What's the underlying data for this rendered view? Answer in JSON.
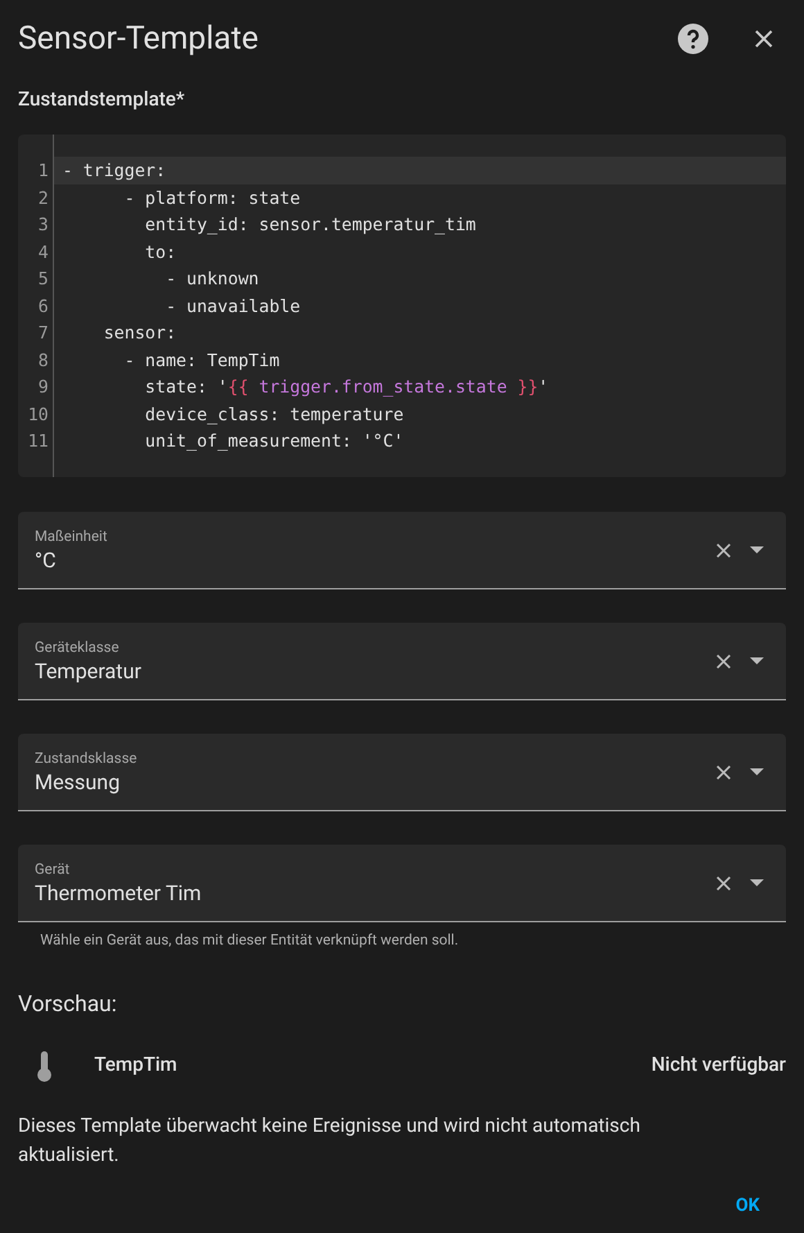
{
  "dialog": {
    "title": "Sensor-Template"
  },
  "template": {
    "label": "Zustandstemplate*",
    "lines": [
      {
        "number": "1",
        "active": true,
        "segments": [
          {
            "kind": "plain",
            "text": "- trigger:"
          }
        ]
      },
      {
        "number": "2",
        "active": false,
        "segments": [
          {
            "kind": "plain",
            "text": "      - platform: state"
          }
        ]
      },
      {
        "number": "3",
        "active": false,
        "segments": [
          {
            "kind": "plain",
            "text": "        entity_id: sensor.temperatur_tim"
          }
        ]
      },
      {
        "number": "4",
        "active": false,
        "segments": [
          {
            "kind": "plain",
            "text": "        to:"
          }
        ]
      },
      {
        "number": "5",
        "active": false,
        "segments": [
          {
            "kind": "plain",
            "text": "          - unknown"
          }
        ]
      },
      {
        "number": "6",
        "active": false,
        "segments": [
          {
            "kind": "plain",
            "text": "          - unavailable"
          }
        ]
      },
      {
        "number": "7",
        "active": false,
        "segments": [
          {
            "kind": "plain",
            "text": "    sensor:"
          }
        ]
      },
      {
        "number": "8",
        "active": false,
        "segments": [
          {
            "kind": "plain",
            "text": "      - name: TempTim"
          }
        ]
      },
      {
        "number": "9",
        "active": false,
        "segments": [
          {
            "kind": "plain",
            "text": "        state: '"
          },
          {
            "kind": "brace",
            "text": "{{"
          },
          {
            "kind": "expr",
            "text": " trigger.from_state.state "
          },
          {
            "kind": "brace",
            "text": "}}"
          },
          {
            "kind": "plain",
            "text": "'"
          }
        ]
      },
      {
        "number": "10",
        "active": false,
        "segments": [
          {
            "kind": "plain",
            "text": "        device_class: temperature"
          }
        ]
      },
      {
        "number": "11",
        "active": false,
        "segments": [
          {
            "kind": "plain",
            "text": "        unit_of_measurement: '°C'"
          }
        ]
      }
    ]
  },
  "fields": [
    {
      "label": "Maßeinheit",
      "value": "°C"
    },
    {
      "label": "Geräteklasse",
      "value": "Temperatur"
    },
    {
      "label": "Zustandsklasse",
      "value": "Messung"
    },
    {
      "label": "Gerät",
      "value": "Thermometer Tim",
      "helper": "Wähle ein Gerät aus, das mit dieser Entität verknüpft werden soll."
    }
  ],
  "preview": {
    "heading": "Vorschau:",
    "entity": {
      "name": "TempTim",
      "state": "Nicht verfügbar"
    },
    "note": "Dieses Template überwacht keine Ereignisse und wird nicht automatisch aktualisiert."
  },
  "buttons": [
    "OK"
  ]
}
